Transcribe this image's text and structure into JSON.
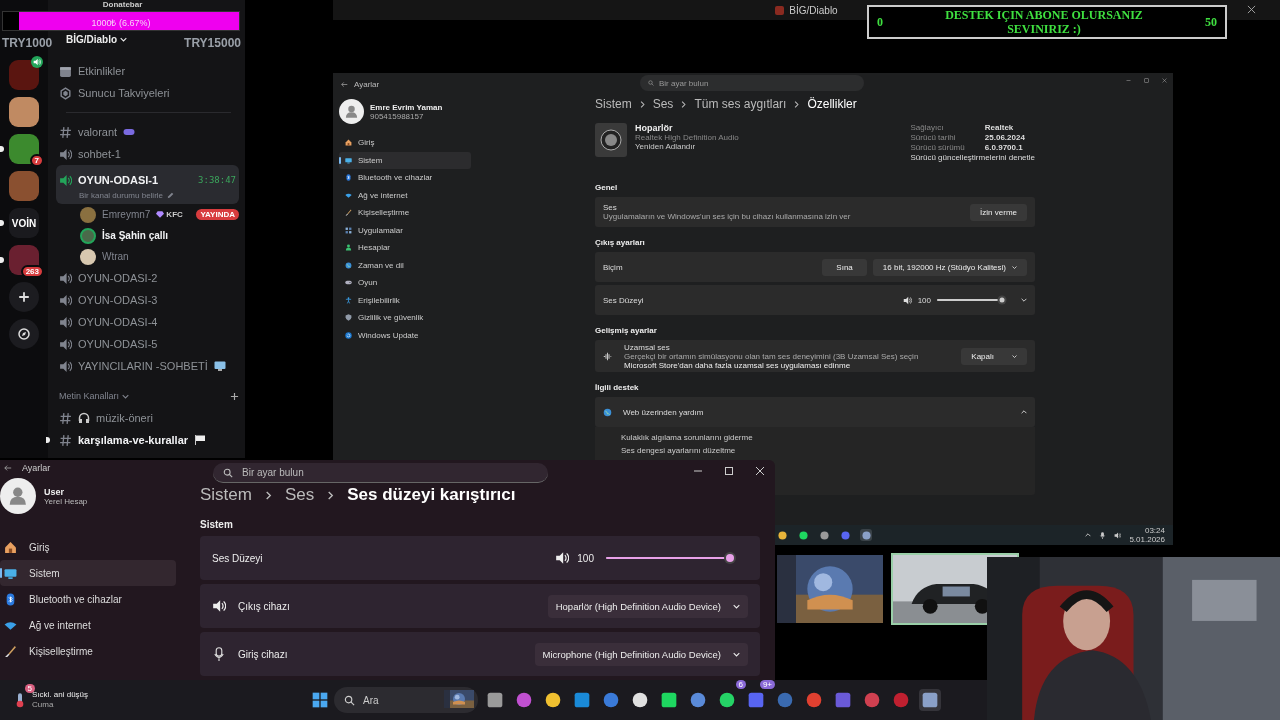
{
  "stream_title": "BİG/Diablo",
  "goal_overlay": {
    "current": "0",
    "message": "DESTEK IÇIN ABONE OLURSANIZ SEVINIRIZ :)",
    "target": "50"
  },
  "discord": {
    "donatebar": {
      "title": "Donatebar",
      "label": "1000₺ (6.67%)",
      "level": 0.0667,
      "min": "TRY1000",
      "max": "TRY15000"
    },
    "server_name": "BİG/Diablo",
    "servers": [
      {
        "kind": "avatar",
        "color": "#5a1510",
        "unread": false,
        "speaking": true
      },
      {
        "kind": "avatar",
        "color": "#c08a62",
        "unread": false,
        "speaking": false
      },
      {
        "kind": "avatar",
        "color": "#3c8a2e",
        "unread": true,
        "speaking": false,
        "badge": "7"
      },
      {
        "kind": "avatar",
        "color": "#8a5030",
        "unread": false,
        "speaking": false
      },
      {
        "kind": "label",
        "label": "VOİN",
        "unread": true
      },
      {
        "kind": "avatar",
        "color": "#6a2030",
        "unread": true,
        "speaking": false,
        "badge": "263"
      },
      {
        "kind": "add"
      },
      {
        "kind": "explore"
      }
    ],
    "channels": [
      {
        "kind": "events",
        "name": "Etkinlikler",
        "selected": false,
        "unread": false
      },
      {
        "kind": "boosts",
        "name": "Sunucu Takviyeleri",
        "selected": false,
        "unread": false
      },
      {
        "kind": "text",
        "name": "valorant",
        "decorations": [
          {
            "kind": "gamepad"
          }
        ],
        "selected": false,
        "unread": false
      },
      {
        "kind": "voice",
        "name": "sohbet-1",
        "selected": false,
        "unread": false
      },
      {
        "kind": "voice",
        "name": "OYUN-ODASI-1",
        "selected": true,
        "unread": false,
        "duration": "3:38:47",
        "status": "Bir kanal durumu belirle",
        "members": [
          {
            "name": "Emreymn7",
            "color": "#8a7040",
            "speaking": false,
            "tag": "KFC",
            "live": true,
            "live_label": "YAYINDA"
          },
          {
            "name": "İsa Şahin çallı",
            "color": "#4a6a4a",
            "speaking": true,
            "live": false
          },
          {
            "name": "Wtran",
            "color": "#d8c8b0",
            "speaking": false,
            "live": false
          }
        ]
      },
      {
        "kind": "voice",
        "name": "OYUN-ODASI-2",
        "selected": false,
        "unread": false
      },
      {
        "kind": "voice",
        "name": "OYUN-ODASI-3",
        "selected": false,
        "unread": false
      },
      {
        "kind": "voice",
        "name": "OYUN-ODASI-4",
        "selected": false,
        "unread": false
      },
      {
        "kind": "voice",
        "name": "OYUN-ODASI-5",
        "selected": false,
        "unread": false
      },
      {
        "kind": "voice",
        "name": "YAYINCILARIN -SOHBETİ",
        "decorations": [
          {
            "kind": "monitor"
          }
        ],
        "selected": false,
        "unread": false
      },
      {
        "kind": "category",
        "name": "Metin Kanalları",
        "selected": false,
        "unread": false
      },
      {
        "kind": "text",
        "name": "müzik-öneri",
        "decorations": [
          {
            "kind": "headphones"
          }
        ],
        "selected": false,
        "unread": false
      },
      {
        "kind": "text",
        "name": "karşılama-ve-kurallar",
        "decorations": [
          {
            "kind": "flag"
          }
        ],
        "selected": false,
        "unread": true
      }
    ]
  },
  "remote": {
    "title": "Ayarlar",
    "search_placeholder": "Bir ayar bulun",
    "user": {
      "name": "Emre Evrim Yaman",
      "detail": "905415988157"
    },
    "nav": [
      {
        "label": "Giriş",
        "selected": false
      },
      {
        "label": "Sistem",
        "selected": true
      },
      {
        "label": "Bluetooth ve cihazlar",
        "selected": false
      },
      {
        "label": "Ağ ve internet",
        "selected": false
      },
      {
        "label": "Kişiselleştirme",
        "selected": false
      },
      {
        "label": "Uygulamalar",
        "selected": false
      },
      {
        "label": "Hesaplar",
        "selected": false
      },
      {
        "label": "Zaman ve dil",
        "selected": false
      },
      {
        "label": "Oyun",
        "selected": false
      },
      {
        "label": "Erişilebilirlik",
        "selected": false
      },
      {
        "label": "Gizlilik ve güvenlik",
        "selected": false
      },
      {
        "label": "Windows Update",
        "selected": false
      }
    ],
    "breadcrumb": [
      "Sistem",
      "Ses",
      "Tüm ses aygıtları",
      "Özellikler"
    ],
    "device": {
      "name": "Hoparlör",
      "driver": "Realtek High Definition Audio",
      "rename": "Yeniden Adlandır"
    },
    "info": [
      {
        "label": "Sağlayıcı",
        "value": "Realtek"
      },
      {
        "label": "Sürücü tarihi",
        "value": "25.06.2024"
      },
      {
        "label": "Sürücü sürümü",
        "value": "6.0.9700.1"
      }
    ],
    "info_link": "Sürücü güncelleştirmelerini denetle",
    "sections": [
      {
        "title": "Genel",
        "rows": [
          {
            "kind": "permission",
            "title": "Ses",
            "description": "Uygulamaların ve Windows'un ses için bu cihazı kullanmasına izin ver",
            "button": "İzin verme"
          }
        ]
      },
      {
        "title": "Çıkış ayarları",
        "rows": [
          {
            "kind": "format",
            "title": "Biçim",
            "button": "Sına",
            "value": "16 bit, 192000 Hz (Stüdyo Kalitesi)"
          },
          {
            "kind": "volume",
            "title": "Ses Düzeyi",
            "reading": "100",
            "level": 0.98
          }
        ]
      },
      {
        "title": "Gelişmiş ayarlar",
        "rows": [
          {
            "kind": "spatial",
            "title": "Uzamsal ses",
            "description": "Gerçekçi bir ortamın simülasyonu olan tam ses deneyimini (3B Uzamsal Ses) seçin",
            "link": "Microsoft Store'dan daha fazla uzamsal ses uygulaması edinme",
            "value": "Kapalı"
          }
        ]
      },
      {
        "title": "İlgili destek",
        "rows": [
          {
            "kind": "help",
            "title": "Web üzerinden yardım",
            "expanded": true,
            "links": [
              "Kulaklık algılama sorunlarını giderme",
              "Ses dengesi ayarlarını düzeltme"
            ]
          }
        ]
      }
    ],
    "taskbar": {
      "apps": [
        {
          "color": "#e8b43a",
          "selected": false
        },
        {
          "color": "#1ed760",
          "selected": false
        },
        {
          "color": "#9a9a9a",
          "selected": false
        },
        {
          "color": "#5865f2",
          "selected": false
        },
        {
          "color": "#8aa0c8",
          "selected": true
        }
      ],
      "time": "03:24",
      "date": "5.01.2026"
    }
  },
  "mixer": {
    "title": "Ayarlar",
    "search_placeholder": "Bir ayar bulun",
    "user": {
      "name": "User",
      "detail": "Yerel Hesap"
    },
    "nav": [
      {
        "label": "Giriş",
        "selected": false
      },
      {
        "label": "Sistem",
        "selected": true
      },
      {
        "label": "Bluetooth ve cihazlar",
        "selected": false
      },
      {
        "label": "Ağ ve internet",
        "selected": false
      },
      {
        "label": "Kişiselleştirme",
        "selected": false
      }
    ],
    "breadcrumb": [
      "Sistem",
      "Ses",
      "Ses düzeyi karıştırıcı"
    ],
    "section": "Sistem",
    "volume": {
      "title": "Ses Düzeyi",
      "reading": "100",
      "level": 1
    },
    "devices": [
      {
        "kind": "output",
        "title": "Çıkış cihazı",
        "value": "Hoparlör (High Definition Audio Device)"
      },
      {
        "kind": "input",
        "title": "Giriş cihazı",
        "value": "Microphone (High Definition Audio Device)"
      }
    ]
  },
  "taskbar": {
    "weather": {
      "badge": "5",
      "title": "Sıckl. ani düşüş",
      "subtitle": "Cuma"
    },
    "search_placeholder": "Ara",
    "apps": [
      {
        "color": "#9a9a9a"
      },
      {
        "color": "#c050d0"
      },
      {
        "color": "#f0c030"
      },
      {
        "color": "#1a8ad8"
      },
      {
        "color": "#3a7ad8"
      },
      {
        "color": "#e0e0e0"
      },
      {
        "color": "#1ed760"
      },
      {
        "color": "#5a8ad8"
      },
      {
        "color": "#25d366",
        "badge": "6"
      },
      {
        "color": "#5865f2",
        "badge": "9+"
      },
      {
        "color": "#3a6ab0"
      },
      {
        "color": "#e04030"
      },
      {
        "color": "#6a5ad8"
      },
      {
        "color": "#d04050"
      },
      {
        "color": "#c02030"
      },
      {
        "color": "#8aa0c8",
        "selected": true
      }
    ]
  },
  "thumbnails": [
    {
      "selected": false
    },
    {
      "selected": true
    }
  ]
}
